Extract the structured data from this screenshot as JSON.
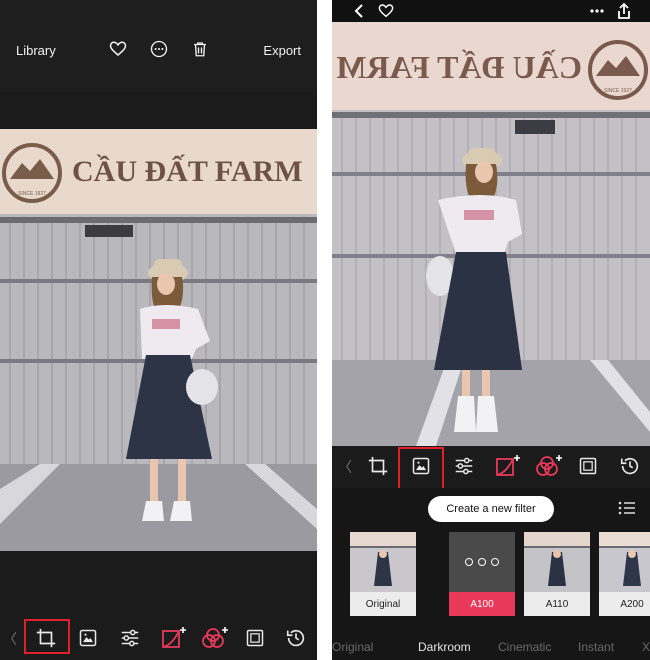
{
  "left_screen": {
    "header": {
      "library_label": "Library",
      "export_label": "Export",
      "icons": [
        "heart-icon",
        "more-icon",
        "trash-icon"
      ]
    },
    "photo": {
      "sign_text": "CẦU ĐẤT FARM",
      "logo_text": "SINCE 1927"
    },
    "toolbar": {
      "back_glyph": "〈",
      "tools": [
        "crop-icon",
        "image-filter-icon",
        "adjust-sliders-icon",
        "curves-icon",
        "color-mix-icon",
        "frame-icon",
        "history-icon"
      ],
      "highlighted_tool": "crop-icon"
    }
  },
  "right_screen": {
    "status": {
      "icons": [
        "back-chevron-icon",
        "heart-icon",
        "more-icon",
        "share-icon"
      ]
    },
    "photo": {
      "sign_text": "CẦU ĐẤT FARM",
      "logo_text": "SINCE 1927"
    },
    "toolbar": {
      "back_glyph": "〈",
      "tools": [
        "crop-icon",
        "image-filter-icon",
        "adjust-sliders-icon",
        "curves-icon",
        "color-mix-icon",
        "frame-icon",
        "history-icon"
      ],
      "highlighted_tool": "image-filter-icon"
    },
    "filter_panel": {
      "create_button": "Create a new filter",
      "filters": [
        {
          "label": "Original",
          "selected": false
        },
        {
          "label": "A100",
          "selected": true
        },
        {
          "label": "A110",
          "selected": false
        },
        {
          "label": "A200",
          "selected": false
        }
      ],
      "categories": [
        {
          "label": "Original",
          "active": false
        },
        {
          "label": "Darkroom",
          "active": true
        },
        {
          "label": "Cinematic",
          "active": false
        },
        {
          "label": "Instant",
          "active": false
        },
        {
          "label": "X",
          "active": false
        }
      ]
    }
  },
  "colors": {
    "highlight": "#e0212b",
    "accent": "#e8395a",
    "dark_bg": "#1b1b1b"
  }
}
